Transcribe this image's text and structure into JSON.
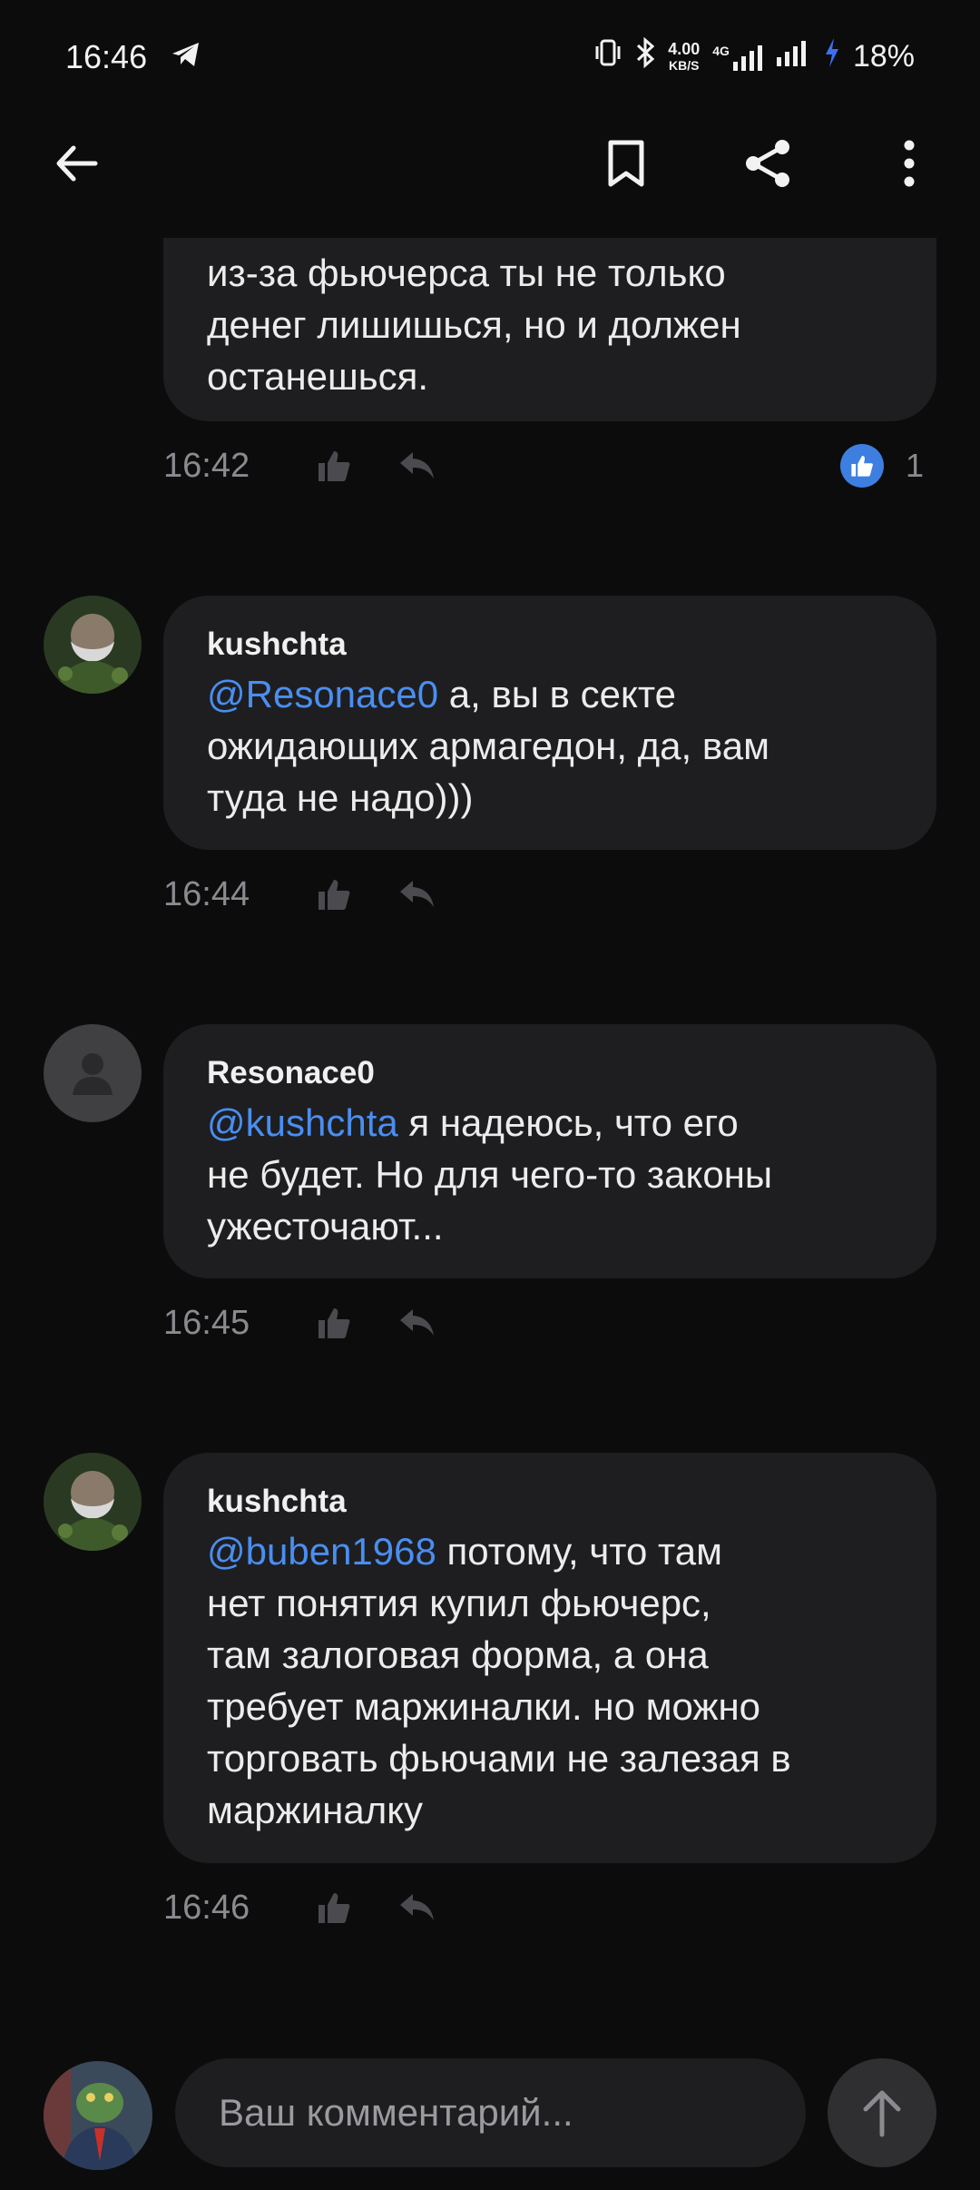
{
  "status": {
    "time": "16:46",
    "net_speed_value": "4.00",
    "net_speed_unit": "KB/S",
    "network": "4G",
    "battery": "18%"
  },
  "comments": [
    {
      "author": "",
      "lines": [
        {
          "mention": "",
          "text": "из-за фьючерса ты не только"
        },
        {
          "mention": "",
          "text": "денег лишишься, но и должен"
        },
        {
          "mention": "",
          "text": "останешься."
        }
      ],
      "time": "16:42",
      "reactions": "1"
    },
    {
      "author": "kushchta",
      "lines": [
        {
          "mention": "@Resonace0",
          "text": " а, вы в секте"
        },
        {
          "mention": "",
          "text": "ожидающих армагедон, да, вам"
        },
        {
          "mention": "",
          "text": "туда не надо)))"
        }
      ],
      "time": "16:44"
    },
    {
      "author": "Resonace0",
      "lines": [
        {
          "mention": "@kushchta",
          "text": " я надеюсь, что его"
        },
        {
          "mention": "",
          "text": "не будет. Но для чего-то законы"
        },
        {
          "mention": "",
          "text": "ужесточают..."
        }
      ],
      "time": "16:45"
    },
    {
      "author": "kushchta",
      "lines": [
        {
          "mention": "@buben1968",
          "text": " потому, что там"
        },
        {
          "mention": "",
          "text": "нет понятия купил фьючерс,"
        },
        {
          "mention": "",
          "text": "там залоговая форма, а она"
        },
        {
          "mention": "",
          "text": "требует маржиналки. но можно"
        },
        {
          "mention": "",
          "text": "торговать фьючами не залезая в"
        },
        {
          "mention": "",
          "text": "маржиналку"
        }
      ],
      "time": "16:46"
    }
  ],
  "composer": {
    "placeholder": "Ваш комментарий..."
  },
  "colors": {
    "background": "#0c0c0d",
    "bubble": "#1e1e20",
    "mention": "#4a8ef0",
    "like_badge": "#3d7fe0"
  }
}
